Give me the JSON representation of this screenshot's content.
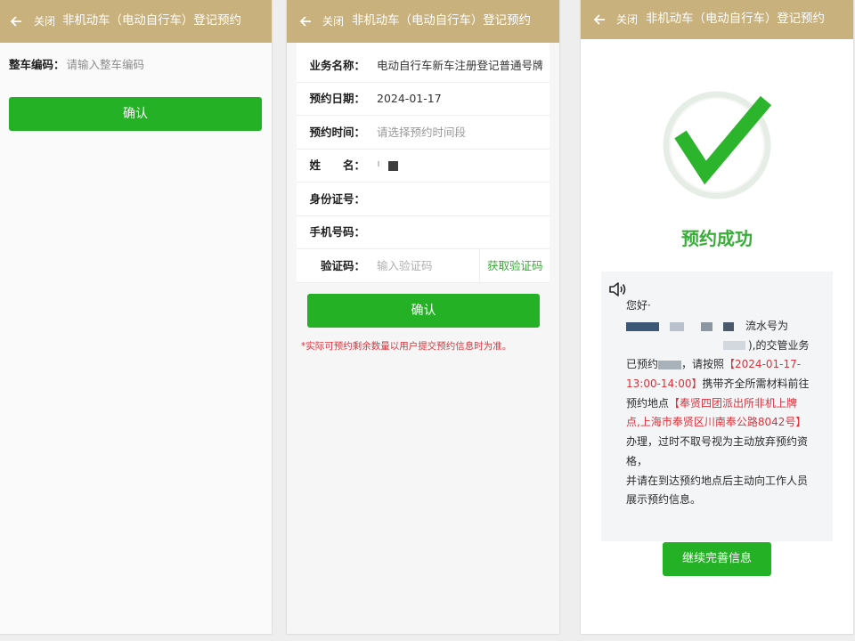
{
  "colors": {
    "page_bg": "#eeeeee",
    "header": "#c8b17c",
    "green": "#25b125",
    "link_green": "#3aa93a",
    "success_green": "#37ae37",
    "red": "#d8343c"
  },
  "icons": {
    "back": "arrow-left-icon",
    "speaker": "speaker-icon",
    "success": "check-circle-icon"
  },
  "header": {
    "close_label": "关闭",
    "title": "非机动车（电动自行车）登记预约"
  },
  "screen1": {
    "field_label": "整车编码：",
    "field_placeholder": "请输入整车编码",
    "confirm_label": "确认"
  },
  "screen2": {
    "fields": [
      {
        "label": "业务名称：",
        "value": "电动自行车新车注册登记普通号牌"
      },
      {
        "label": "预约日期：",
        "value": "2024-01-17"
      },
      {
        "label": "预约时间：",
        "placeholder": "请选择预约时间段"
      },
      {
        "label": "姓　　名："
      },
      {
        "label": "身份证号："
      },
      {
        "label": "手机号码："
      },
      {
        "label": "验证码：",
        "placeholder": "输入验证码"
      }
    ],
    "captcha_button": "获取验证码",
    "confirm_label": "确认",
    "note": "*实际可预约剩余数量以用户提交预约信息时为准。"
  },
  "screen3": {
    "status": "预约成功",
    "message": {
      "greeting": "您好·",
      "serial_label": "流水号为",
      "business_text": "),的交管业务",
      "booked_a": "已预约",
      "booked_b": "，请按照",
      "date_part": "【2024-01-17-",
      "time_part": "13:00-14:00】",
      "bring_text": "携带齐全所需材料前往",
      "place_label": "预约地点",
      "place_line1": "【奉贤四团派出所非机上牌",
      "place_line2": "点,上海市奉贤区川南奉公路8042号】",
      "handle_line1": "办理，过时不取号视为主动放弃预约资",
      "handle_line2": "格，",
      "show_line1": "并请在到达预约地点后主动向工作人员",
      "show_line2": "展示预约信息。"
    },
    "continue_label": "继续完善信息"
  }
}
